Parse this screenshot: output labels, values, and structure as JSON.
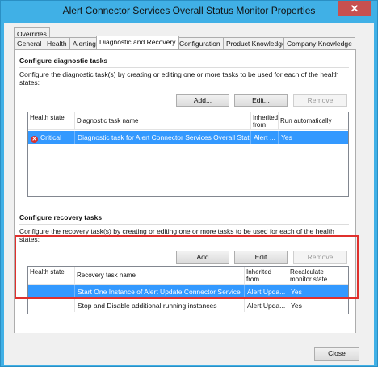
{
  "window": {
    "title": "Alert Connector Services Overall Status Monitor Properties",
    "close_glyph": "✕"
  },
  "tabs": {
    "overrides": "Overrides",
    "general": "General",
    "health": "Health",
    "alerting": "Alerting",
    "diagnostic": "Diagnostic and Recovery",
    "configuration": "Configuration",
    "product_knowledge": "Product Knowledge",
    "company_knowledge": "Company Knowledge"
  },
  "diagnostic": {
    "heading": "Configure diagnostic tasks",
    "description": "Configure the diagnostic task(s) by creating or editing one or more tasks to be used for each of the health states:",
    "add_label": "Add...",
    "edit_label": "Edit...",
    "remove_label": "Remove",
    "columns": [
      "Health state",
      "Diagnostic task name",
      "Inherited from",
      "Run automatically"
    ],
    "rows": [
      {
        "state": "Critical",
        "name": "Diagnostic task for Alert Connector Services Overall Statu...",
        "inherited": "Alert ...",
        "auto": "Yes"
      }
    ]
  },
  "recovery": {
    "heading": "Configure recovery tasks",
    "description": "Configure the recovery task(s) by creating or editing one or more tasks to be used for each of the health states:",
    "add_label": "Add",
    "edit_label": "Edit",
    "remove_label": "Remove",
    "columns": [
      "Health state",
      "Recovery task name",
      "Inherited from",
      "Recalculate monitor state"
    ],
    "rows": [
      {
        "state": "",
        "name": "Start One Instance of Alert Update Connector Service",
        "inherited": "Alert Upda...",
        "recalc": "Yes"
      },
      {
        "state": "",
        "name": "Stop and Disable additional running instances",
        "inherited": "Alert Upda...",
        "recalc": "Yes"
      }
    ]
  },
  "footer": {
    "close_label": "Close"
  },
  "colors": {
    "title_bar": "#40b0e6",
    "selection": "#3399ff",
    "highlight_box": "#e0302c"
  }
}
